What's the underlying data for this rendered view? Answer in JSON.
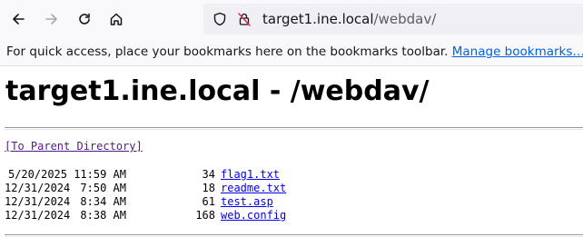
{
  "browser": {
    "url_host": "target1.ine.local",
    "url_path": "/webdav/"
  },
  "bookmarks_bar": {
    "message": "For quick access, place your bookmarks here on the bookmarks toolbar.",
    "manage_link": "Manage bookmarks…"
  },
  "page": {
    "heading": "target1.ine.local - /webdav/",
    "parent_link": "[To Parent Directory]",
    "files": [
      {
        "date": "5/20/2025",
        "time": "11:59 AM",
        "size": "34",
        "name": "flag1.txt"
      },
      {
        "date": "12/31/2024",
        "time": "7:50 AM",
        "size": "18",
        "name": "readme.txt"
      },
      {
        "date": "12/31/2024",
        "time": "8:34 AM",
        "size": "61",
        "name": "test.asp"
      },
      {
        "date": "12/31/2024",
        "time": "8:38 AM",
        "size": "168",
        "name": "web.config"
      }
    ]
  },
  "colors": {
    "link": "#0000ee",
    "visited_link": "#551a8b",
    "toolbar_bg": "#f9f9fb",
    "urlbar_bg": "#f0f0f4"
  }
}
